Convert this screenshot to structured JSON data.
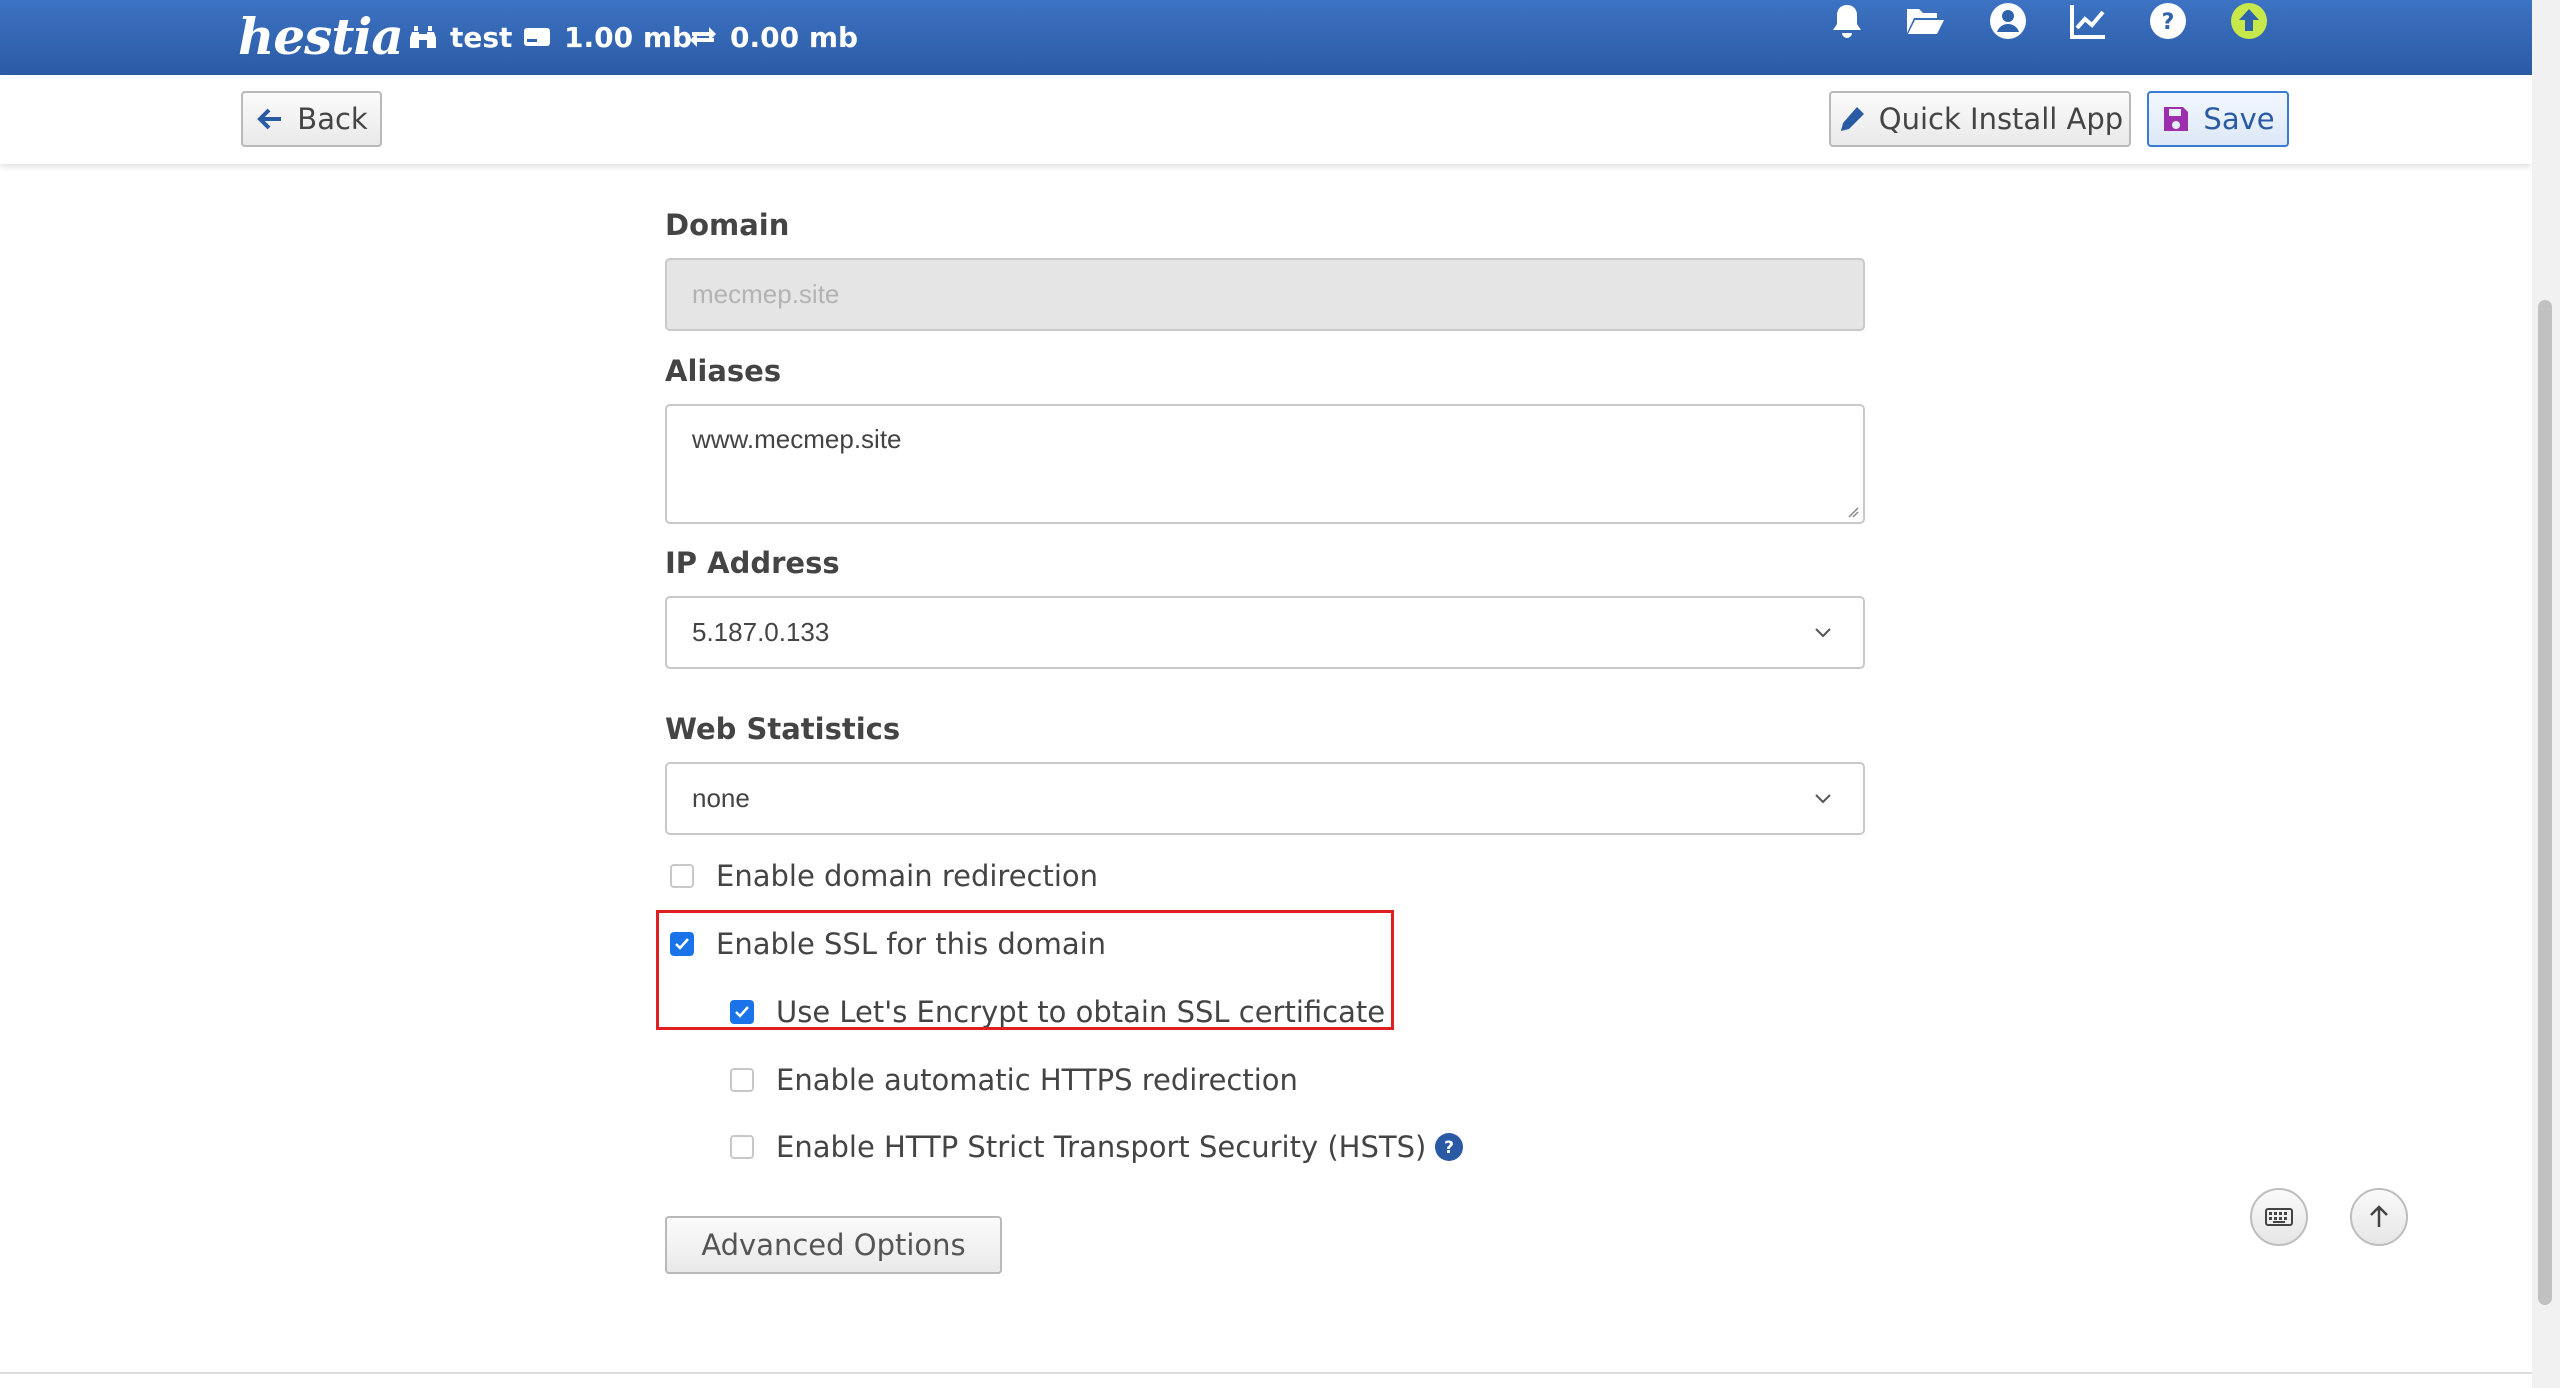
{
  "topbar": {
    "logo": "hestia",
    "user": "test",
    "disk": "1.00 mb",
    "bandwidth": "0.00 mb",
    "icons": [
      "bell-icon",
      "folder-open-icon",
      "user-circle-icon",
      "chart-line-icon",
      "question-circle-icon",
      "arrow-up-circle-icon"
    ],
    "update_color": "#c7e84a"
  },
  "toolbar": {
    "back_label": "Back",
    "quick_install_label": "Quick Install App",
    "save_label": "Save"
  },
  "form": {
    "domain_label": "Domain",
    "domain_value": "mecmep.site",
    "aliases_label": "Aliases",
    "aliases_value": "www.mecmep.site",
    "ip_label": "IP Address",
    "ip_value": "5.187.0.133",
    "stats_label": "Web Statistics",
    "stats_value": "none",
    "checks": {
      "redirect": {
        "label": "Enable domain redirection",
        "checked": false
      },
      "ssl": {
        "label": "Enable SSL for this domain",
        "checked": true
      },
      "letsencrypt": {
        "label": "Use Let's Encrypt to obtain SSL certificate",
        "checked": true
      },
      "https_redirect": {
        "label": "Enable automatic HTTPS redirection",
        "checked": false
      },
      "hsts": {
        "label": "Enable HTTP Strict Transport Security (HSTS)",
        "checked": false
      }
    },
    "advanced_label": "Advanced Options"
  },
  "colors": {
    "accent": "#2b5aa5",
    "checkbox": "#1a73e8",
    "highlight": "#e02020"
  }
}
